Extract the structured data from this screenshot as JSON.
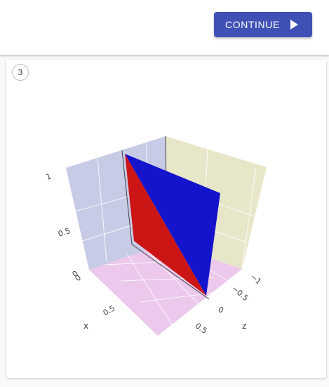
{
  "toolbar": {
    "continue_label": "CONTINUE"
  },
  "card": {
    "badge": "3"
  },
  "plot": {
    "z_ticks": {
      "t1": "1",
      "t2": "0.5",
      "t3": "0"
    },
    "x_ticks": {
      "t1": "0",
      "t2": "0.5"
    },
    "x_title": "x",
    "y_ticks": {
      "t1": "−1",
      "t2": "−0.5",
      "t3": "0",
      "t4": "0.5"
    },
    "y_title": "z",
    "colors": {
      "left_wall": "#c7cbe6",
      "right_wall": "#e7e6c9",
      "floor": "#ebc8ec",
      "red_face": "#cc1616",
      "blue_face": "#1414cc",
      "button": "#3f51b5"
    }
  }
}
